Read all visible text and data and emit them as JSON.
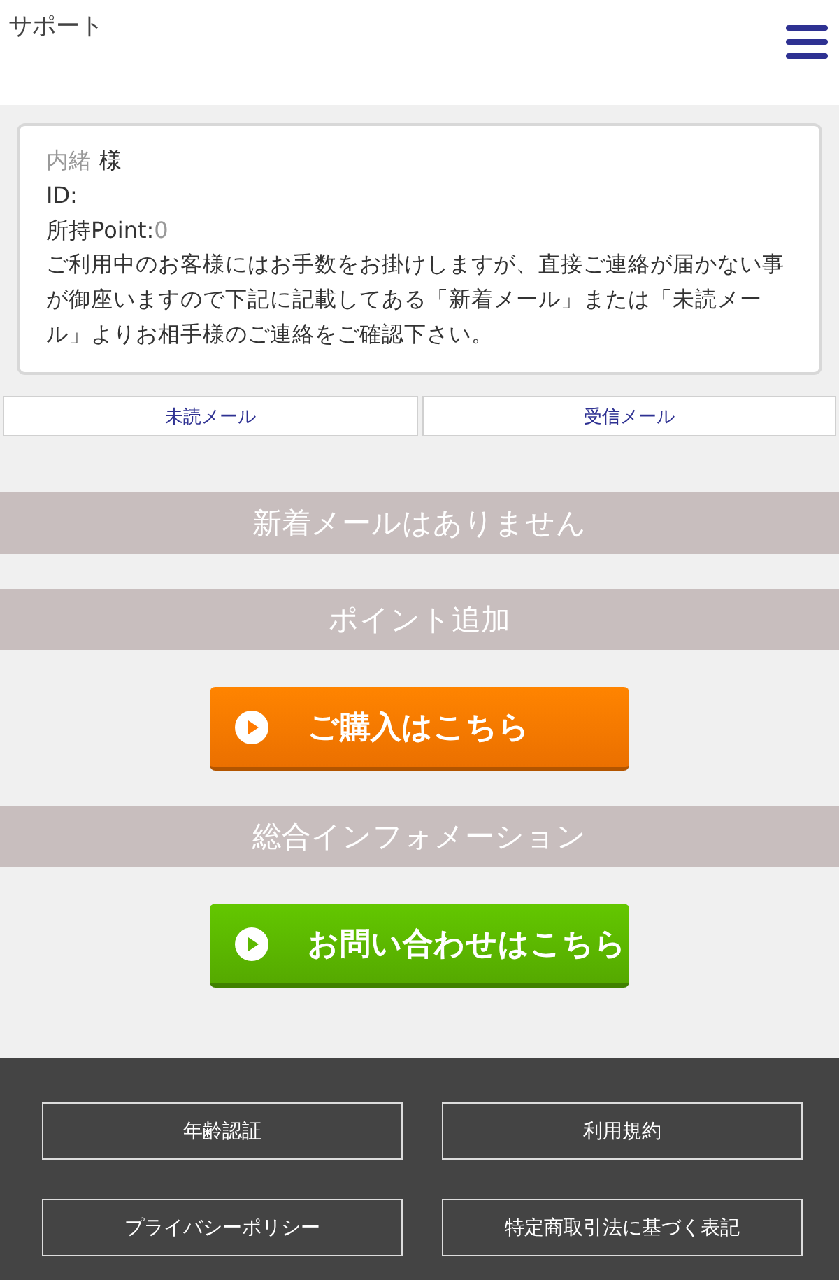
{
  "header": {
    "title": "サポート"
  },
  "account": {
    "name": "内緒",
    "honorific": "様",
    "id_label": "ID:",
    "point_label": "所持Point:",
    "point_value": "0",
    "notice": "ご利用中のお客様にはお手数をお掛けしますが、直接ご連絡が届かない事が御座いますので下記に記載してある「新着メール」または「未読メール」よりお相手様のご連絡をご確認下さい。"
  },
  "mail_tabs": [
    "未読メール",
    "受信メール"
  ],
  "sections": [
    {
      "heading": "新着メールはありません"
    },
    {
      "heading": "ポイント追加",
      "button": {
        "label": "ご購入はこちら",
        "color": "#ff7a00"
      }
    },
    {
      "heading": "総合インフォメーション",
      "button": {
        "label": "お問い合わせはこちら",
        "color": "#5cb800"
      }
    }
  ],
  "footer_links": [
    "年齢認証",
    "利用規約",
    "プライバシーポリシー",
    "特定商取引法に基づく表記"
  ]
}
